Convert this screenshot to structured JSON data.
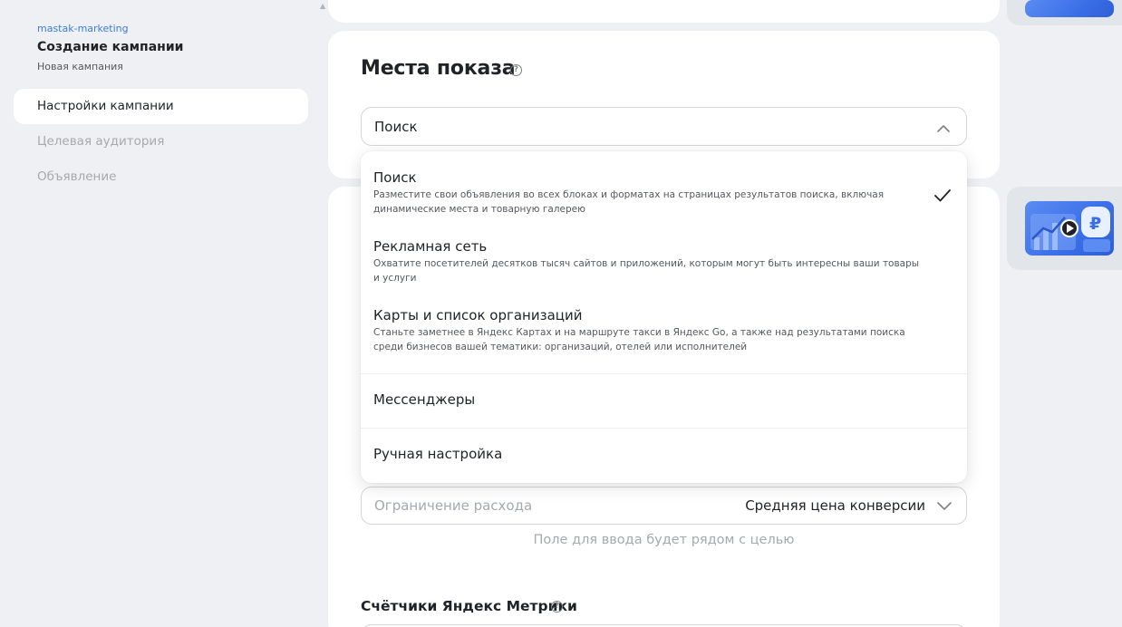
{
  "sidebar": {
    "account": "mastak-marketing",
    "title": "Создание кампании",
    "subtitle": "Новая кампания",
    "items": [
      {
        "label": "Настройки кампании",
        "active": true
      },
      {
        "label": "Целевая аудитория",
        "active": false
      },
      {
        "label": "Объявление",
        "active": false
      }
    ]
  },
  "placements": {
    "title": "Места показа",
    "help_icon": "question-circle-icon",
    "selected": "Поиск",
    "options": [
      {
        "title": "Поиск",
        "description": "Разместите свои объявления во всех блоках и форматах на страницах результатов поиска, включая динамические места и товарную галерею",
        "checked": true
      },
      {
        "title": "Рекламная сеть",
        "description": "Охватите посетителей десятков тысяч сайтов и приложений, которым могут быть интересны ваши товары и услуги",
        "checked": false
      },
      {
        "title": "Карты и список организаций",
        "description": "Станьте заметнее в Яндекс Картах и на маршруте такси в Яндекс Go, а также над результатами поиска среди бизнесов вашей тематики: организаций, отелей или исполнителей",
        "checked": false
      },
      {
        "title": "Мессенджеры",
        "description": "",
        "checked": false
      },
      {
        "title": "Ручная настройка",
        "description": "",
        "checked": false
      }
    ]
  },
  "budget": {
    "limit_label": "Ограничение расхода",
    "limit_value": "Средняя цена конверсии",
    "hint": "Поле для ввода будет рядом с целью"
  },
  "metrics": {
    "title": "Счётчики Яндекс Метрики"
  },
  "promo": {
    "icon": "ruble-chart-video-illustration",
    "ruble_symbol": "₽"
  },
  "colors": {
    "accent": "#3b7ddd",
    "promo_blue": "#3a6fe8",
    "background": "#eef0f3"
  }
}
